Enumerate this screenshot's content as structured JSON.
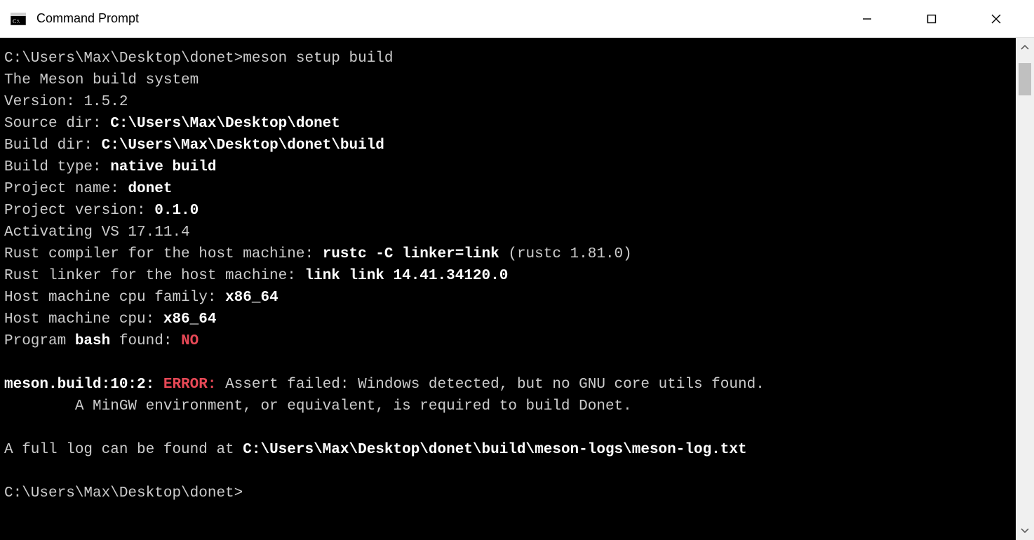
{
  "window": {
    "title": "Command Prompt"
  },
  "console": {
    "prompt_path": "C:\\Users\\Max\\Desktop\\donet>",
    "command": "meson setup build",
    "lines": {
      "meson_build_system": "The Meson build system",
      "version": "Version: 1.5.2",
      "source_dir_label": "Source dir: ",
      "source_dir_value": "C:\\Users\\Max\\Desktop\\donet",
      "build_dir_label": "Build dir: ",
      "build_dir_value": "C:\\Users\\Max\\Desktop\\donet\\build",
      "build_type_label": "Build type: ",
      "build_type_value": "native build",
      "project_name_label": "Project name: ",
      "project_name_value": "donet",
      "project_version_label": "Project version: ",
      "project_version_value": "0.1.0",
      "activating_vs": "Activating VS 17.11.4",
      "rust_compiler_label": "Rust compiler for the host machine: ",
      "rust_compiler_cmd": "rustc -C linker=link",
      "rust_compiler_ver": " (rustc 1.81.0)",
      "rust_linker_label": "Rust linker for the host machine: ",
      "rust_linker_value": "link link 14.41.34120.0",
      "cpu_family_label": "Host machine cpu family: ",
      "cpu_family_value": "x86_64",
      "cpu_label": "Host machine cpu: ",
      "cpu_value": "x86_64",
      "program_label": "Program ",
      "program_name": "bash",
      "program_found": " found: ",
      "program_result": "NO",
      "error_loc": "meson.build:10:2: ",
      "error_tag": "ERROR:",
      "error_msg1": " Assert failed: Windows detected, but no GNU core utils found.",
      "error_msg2": "        A MinGW environment, or equivalent, is required to build Donet.",
      "log_label": "A full log can be found at ",
      "log_path": "C:\\Users\\Max\\Desktop\\donet\\build\\meson-logs\\meson-log.txt",
      "final_prompt": "C:\\Users\\Max\\Desktop\\donet>"
    }
  }
}
